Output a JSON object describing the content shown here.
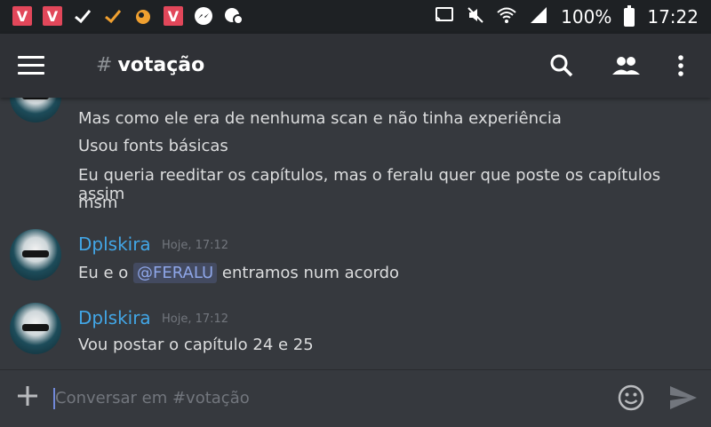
{
  "status_bar": {
    "battery_percent": "100%",
    "time": "17:22",
    "notification_icons": [
      "vivaldi-icon",
      "vivaldi-icon",
      "check-icon",
      "check-orange-icon",
      "uc-browser-icon",
      "vivaldi-icon",
      "messenger-icon",
      "chat-heads-icon"
    ]
  },
  "app_bar": {
    "channel_hash": "#",
    "channel_name": "votação"
  },
  "messages": [
    {
      "author": "",
      "timestamp": "",
      "lines": [
        "Mas como ele era de nenhuma scan e não tinha experiência",
        "Usou fonts básicas",
        "Eu queria reeditar os capítulos, mas o feralu quer que poste os capítulos assim",
        "msm"
      ]
    },
    {
      "author": "Dplskira",
      "timestamp": "Hoje, 17:12",
      "line_before": "Eu e o",
      "mention": "@FERALU",
      "line_after": "entramos num acordo"
    },
    {
      "author": "Dplskira",
      "timestamp": "Hoje, 17:12",
      "lines": [
        "Vou postar o capítulo 24 e 25"
      ]
    }
  ],
  "composer": {
    "placeholder": "Conversar em #votação"
  },
  "colors": {
    "accent": "#7289da",
    "author_name": "#42a6e6",
    "background": "#36393e",
    "app_bar": "#2f3136",
    "status_bar": "#1e2124"
  }
}
